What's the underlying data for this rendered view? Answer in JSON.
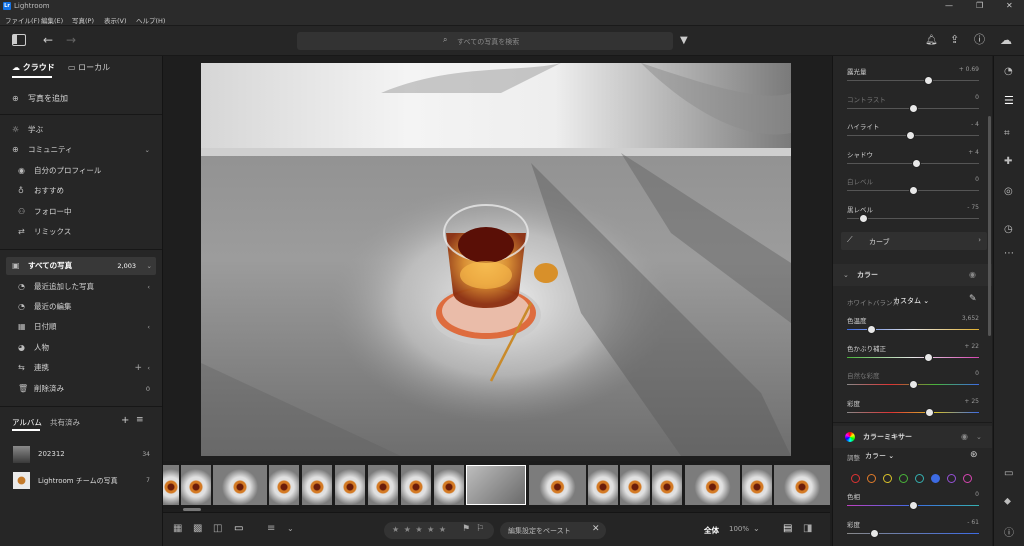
{
  "window": {
    "title": "Lightroom",
    "app_icon_text": "Lr",
    "controls": [
      "—",
      "❐",
      "✕"
    ]
  },
  "menu": [
    "ファイル(F)",
    "編集(E)",
    "写真(P)",
    "表示(V)",
    "ヘルプ(H)"
  ],
  "toolbar": {
    "search_placeholder": "すべての写真を検索"
  },
  "left": {
    "tab_cloud": "クラウド",
    "tab_local": "ローカル",
    "add_photos": "写真を追加",
    "learn": "学ぶ",
    "community": "コミュニティ",
    "my_profile": "自分のプロフィール",
    "recommended": "おすすめ",
    "following": "フォロー中",
    "remix": "リミックス",
    "all_photos": "すべての写真",
    "all_photos_count": "2,003",
    "recently_added": "最近追加した写真",
    "recent_edits": "最近の編集",
    "by_date": "日付順",
    "people": "人物",
    "sync": "連携",
    "deleted": "削除済み",
    "deleted_count": "0",
    "album_tab": "アルバム",
    "shared_tab": "共有済み",
    "albums": [
      {
        "name": "202312",
        "count": "34"
      },
      {
        "name": "Lightroom チームの写真",
        "count": "7"
      }
    ]
  },
  "bottom": {
    "stars": "★ ★ ★ ★ ★",
    "paste_label": "編集設定をペースト",
    "view_label": "全体",
    "zoom": "100%"
  },
  "right": {
    "light": [
      {
        "name": "露光量",
        "value": "+ 0.69",
        "pos": 0.61
      },
      {
        "name": "コントラスト",
        "value": "0",
        "pos": 0.5,
        "dim": true
      },
      {
        "name": "ハイライト",
        "value": "- 4",
        "pos": 0.48
      },
      {
        "name": "シャドウ",
        "value": "+ 4",
        "pos": 0.52
      },
      {
        "name": "白レベル",
        "value": "0",
        "pos": 0.5,
        "dim": true
      },
      {
        "name": "黒レベル",
        "value": "- 75",
        "pos": 0.12
      }
    ],
    "curve_label": "カーブ",
    "color_header": "カラー",
    "wb_label": "ホワイトバランス",
    "wb_value": "カスタム",
    "color_sliders": [
      {
        "name": "色温度",
        "value": "3,652",
        "pos": 0.18
      },
      {
        "name": "色かぶり補正",
        "value": "+ 22",
        "pos": 0.61
      },
      {
        "name": "自然な彩度",
        "value": "0",
        "pos": 0.5,
        "dim": true
      },
      {
        "name": "彩度",
        "value": "+ 25",
        "pos": 0.62
      }
    ],
    "mixer_header": "カラーミキサー",
    "adjust_label": "調整",
    "adjust_value": "カラー",
    "hue_label": "色相",
    "hue_value": "0",
    "sat_label": "彩度",
    "sat_value": "- 61",
    "mixer_colors": [
      "#d33",
      "#e07b2a",
      "#d8c12a",
      "#49b43a",
      "#35b0b0",
      "#3d6be3",
      "#9550d6",
      "#d545b0"
    ]
  }
}
